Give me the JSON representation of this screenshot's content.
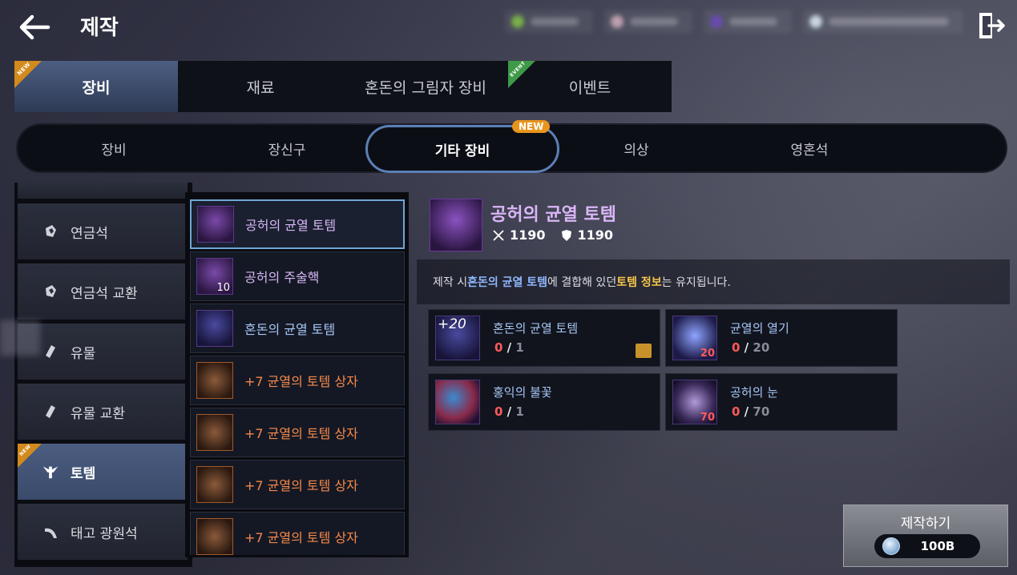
{
  "header": {
    "title": "제작",
    "back_icon": "arrow-left-icon",
    "exit_icon": "exit-door-icon"
  },
  "main_tabs": [
    {
      "label": "장비",
      "badge": "NEW",
      "active": true
    },
    {
      "label": "재료"
    },
    {
      "label": "혼돈의 그림자 장비"
    },
    {
      "label": "이벤트",
      "badge": "EVENT"
    }
  ],
  "sub_tabs": [
    {
      "label": "장비"
    },
    {
      "label": "장신구"
    },
    {
      "label": "기타 장비",
      "badge": "NEW",
      "active": true
    },
    {
      "label": "의상"
    },
    {
      "label": "영혼석"
    }
  ],
  "categories": [
    {
      "label": "연금석",
      "icon": "alchemy-stone-icon"
    },
    {
      "label": "연금석 교환",
      "icon": "alchemy-stone-exchange-icon"
    },
    {
      "label": "유물",
      "icon": "relic-icon"
    },
    {
      "label": "유물 교환",
      "icon": "relic-exchange-icon"
    },
    {
      "label": "토템",
      "icon": "totem-icon",
      "badge": "NEW",
      "active": true
    },
    {
      "label": "태고 광원석",
      "icon": "primal-lightstone-icon"
    }
  ],
  "recipes": [
    {
      "name": "공허의 균열 토템",
      "grade": "purple",
      "selected": true
    },
    {
      "name": "공허의 주술핵",
      "grade": "purple",
      "count": "10"
    },
    {
      "name": "혼돈의 균열 토템",
      "grade": "blue"
    },
    {
      "name": "+7 균열의 토템 상자",
      "grade": "orange"
    },
    {
      "name": "+7 균열의 토템 상자",
      "grade": "orange"
    },
    {
      "name": "+7 균열의 토템 상자",
      "grade": "orange"
    },
    {
      "name": "+7 균열의 토템 상자",
      "grade": "orange"
    }
  ],
  "detail": {
    "title": "공허의 균열 토템",
    "attack": "1190",
    "defense": "1190",
    "notice": {
      "part1": "제작 시 ",
      "hl1": "혼돈의 균열 토템",
      "part2": "에 결합해 있던 ",
      "hl2": "토템 정보",
      "part3": "는 유지됩니다."
    }
  },
  "materials": [
    {
      "name": "혼돈의 균열 토템",
      "have": "0",
      "need": "1",
      "plus": "+20",
      "swap": true
    },
    {
      "name": "균열의 열기",
      "have": "0",
      "need": "20",
      "badge": "20"
    },
    {
      "name": "홍익의 불꽃",
      "have": "0",
      "need": "1"
    },
    {
      "name": "공허의 눈",
      "have": "0",
      "need": "70",
      "badge": "70"
    }
  ],
  "craft": {
    "label": "제작하기",
    "cost": "100B",
    "coin_icon": "silver-coin-icon"
  },
  "colors": {
    "accent_blue": "#5b7fb6",
    "new_badge": "#e8951f",
    "event_badge": "#3e9a47",
    "grade_purple": "#d7b7f5",
    "grade_blue": "#a7c7f5",
    "grade_orange": "#f4884a",
    "warning_red": "#ff5a5a",
    "highlight_yellow": "#f6c54a"
  }
}
